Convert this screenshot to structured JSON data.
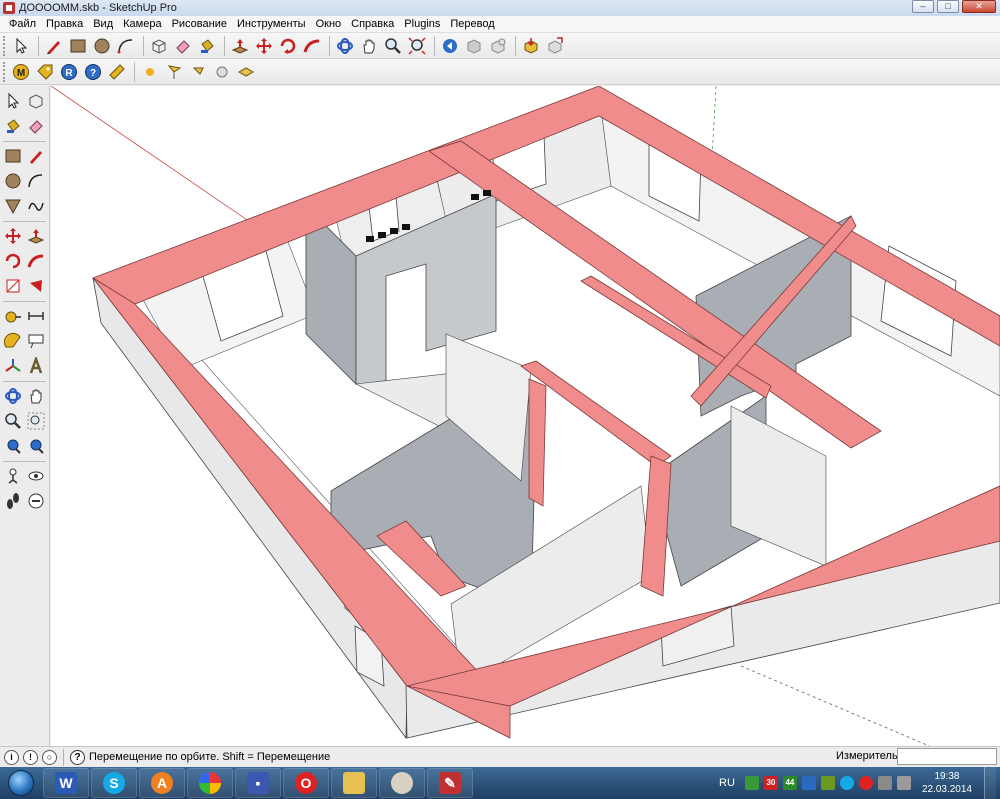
{
  "window": {
    "title": "ДОООOMM.skb - SketchUp Pro",
    "buttons": {
      "minimize": "–",
      "maximize": "□",
      "close": "✕"
    }
  },
  "menu": [
    "Файл",
    "Правка",
    "Вид",
    "Камера",
    "Рисование",
    "Инструменты",
    "Окно",
    "Справка",
    "Plugins",
    "Перевод"
  ],
  "toolbar1": [
    "select-tool",
    "pencil-tool",
    "rectangle-tool",
    "circle-tool",
    "arc-tool",
    "make-component-tool",
    "eraser-tool",
    "paint-bucket-tool",
    "push-pull-tool",
    "move-tool",
    "rotate-tool",
    "follow-me-tool",
    "orbit-tool",
    "pan-tool",
    "zoom-tool",
    "zoom-extents-tool",
    "previous-view-tool",
    "next-view-tool",
    "get-models-tool",
    "share-model-tool",
    "share-component-tool"
  ],
  "toolbar2": [
    "plugin-m-icon",
    "plugin-tag-icon",
    "plugin-r-icon",
    "plugin-help-icon",
    "plugin-ruler-icon",
    "sun-icon",
    "flag-icon",
    "light-icon",
    "sphere-icon",
    "stairs-icon"
  ],
  "palette": [
    [
      "select-tool",
      "make-component-tool"
    ],
    [
      "paint-bucket-tool",
      "eraser-tool"
    ],
    [
      "rectangle-tool",
      "line-tool"
    ],
    [
      "circle-tool",
      "arc-tool"
    ],
    [
      "polygon-tool",
      "freehand-tool"
    ],
    [
      "move-tool",
      "push-pull-tool"
    ],
    [
      "rotate-tool",
      "follow-me-tool"
    ],
    [
      "scale-tool",
      "offset-tool"
    ],
    [
      "tape-measure-tool",
      "dimension-tool"
    ],
    [
      "protractor-tool",
      "text-tool"
    ],
    [
      "axes-tool",
      "3d-text-tool"
    ],
    [
      "orbit-tool",
      "pan-tool"
    ],
    [
      "zoom-tool",
      "zoom-window-tool"
    ],
    [
      "zoom-extents-tool",
      "previous-view-tool"
    ],
    [
      "position-camera-tool",
      "look-around-tool"
    ],
    [
      "walk-tool",
      "section-plane-tool"
    ]
  ],
  "status": {
    "hint": "Перемещение по орбите.  Shift = Перемещение",
    "measure_label": "Измеритель",
    "measure_value": ""
  },
  "colors": {
    "wall_cut": "#f08c8c",
    "wall_light": "#ececec",
    "wall_dark": "#a9aeb4",
    "floor": "#ffffff"
  },
  "taskbar": {
    "apps": [
      "word-icon",
      "skype-icon",
      "avast-icon",
      "picasa-icon",
      "save-disk-icon",
      "opera-icon",
      "explorer-folder-icon",
      "paint-palette-icon",
      "sketchup-icon"
    ],
    "tray": {
      "language": "RU",
      "badges": [
        "30",
        "44"
      ],
      "time": "19:38",
      "date": "22.03.2014"
    }
  }
}
